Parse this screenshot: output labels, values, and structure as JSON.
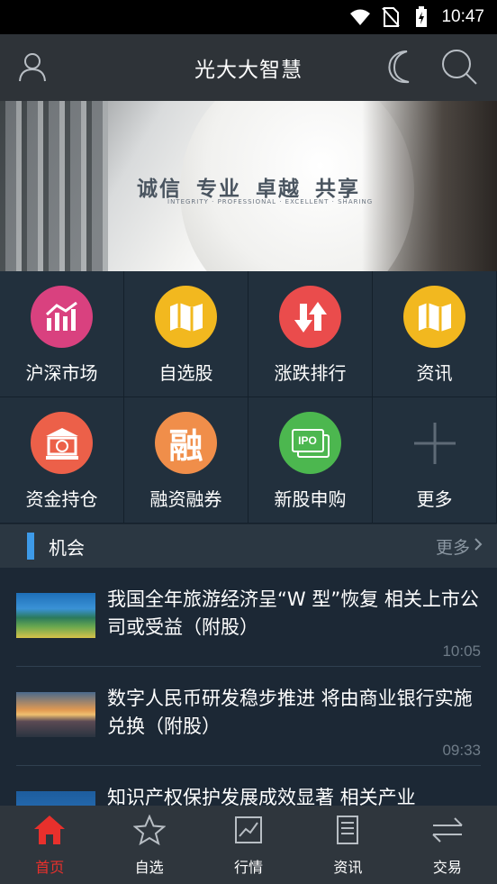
{
  "status_bar": {
    "time": "10:47"
  },
  "header": {
    "title": "光大大智慧",
    "user_icon": "user-icon",
    "night_icon": "moon-icon",
    "search_icon": "search-icon"
  },
  "banner": {
    "slogan": "诚信 专业 卓越 共享",
    "sub": "INTEGRITY · PROFESSIONAL · EXCELLENT · SHARING"
  },
  "grid": [
    {
      "label": "沪深市场",
      "icon": "market-chart-icon",
      "color": "#d9417f"
    },
    {
      "label": "自选股",
      "icon": "map-icon",
      "color": "#f2b81f"
    },
    {
      "label": "涨跌排行",
      "icon": "up-down-arrows-icon",
      "color": "#ea4c4c"
    },
    {
      "label": "资讯",
      "icon": "map-icon",
      "color": "#f2b81f"
    },
    {
      "label": "资金持仓",
      "icon": "bank-icon",
      "color": "#ec6049"
    },
    {
      "label": "融资融券",
      "icon": "rong-char-icon",
      "color": "#f08e4a",
      "glyph": "融"
    },
    {
      "label": "新股申购",
      "icon": "ipo-icon",
      "color": "#4cb74f",
      "glyph": "IPO"
    },
    {
      "label": "更多",
      "icon": "plus-icon",
      "color": "#5e6a76"
    }
  ],
  "section": {
    "title": "机会",
    "more": "更多"
  },
  "news": [
    {
      "headline": "我国全年旅游经济呈“W 型”恢复 相关上市公司或受益（附股）",
      "time": "10:05"
    },
    {
      "headline": "数字人民币研发稳步推进 将由商业银行实施兑换（附股）",
      "time": "09:33"
    },
    {
      "headline": "知识产权保护发展成效显著 相关产业",
      "time": ""
    }
  ],
  "tabs": [
    {
      "label": "首页",
      "icon": "home-icon",
      "active": true
    },
    {
      "label": "自选",
      "icon": "star-icon",
      "active": false
    },
    {
      "label": "行情",
      "icon": "chart-icon",
      "active": false
    },
    {
      "label": "资讯",
      "icon": "document-icon",
      "active": false
    },
    {
      "label": "交易",
      "icon": "exchange-icon",
      "active": false
    }
  ],
  "colors": {
    "active": "#e8302c",
    "accent_blue": "#3d9ae8"
  }
}
